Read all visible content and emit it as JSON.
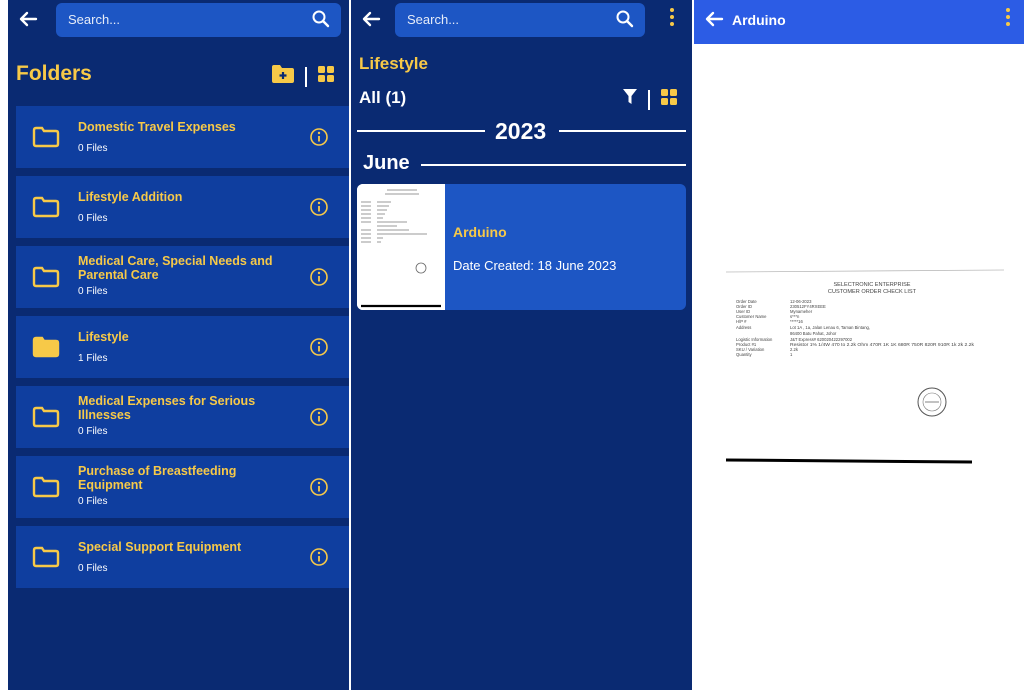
{
  "screen1": {
    "search_placeholder": "Search...",
    "title": "Folders",
    "folders": [
      {
        "name": "Domestic Travel Expenses",
        "count": "0 Files",
        "filled": false
      },
      {
        "name": "Lifestyle Addition",
        "count": "0 Files",
        "filled": false
      },
      {
        "name": "Medical Care, Special Needs and Parental Care",
        "count": "0 Files",
        "filled": false
      },
      {
        "name": "Lifestyle",
        "count": "1 Files",
        "filled": true
      },
      {
        "name": "Medical Expenses for Serious Illnesses",
        "count": "0 Files",
        "filled": false
      },
      {
        "name": "Purchase of Breastfeeding Equipment",
        "count": "0 Files",
        "filled": false
      },
      {
        "name": "Special Support Equipment",
        "count": "0 Files",
        "filled": false
      }
    ]
  },
  "screen2": {
    "search_placeholder": "Search...",
    "title": "Lifestyle",
    "filter_label": "All (1)",
    "year": "2023",
    "month": "June",
    "document": {
      "title": "Arduino",
      "date": "Date Created: 18 June 2023"
    }
  },
  "screen3": {
    "title": "Arduino",
    "receipt": {
      "company": "SELECTRONIC ENTERPRISE",
      "heading": "CUSTOMER ORDER CHECK LIST",
      "fields": [
        {
          "label": "Order Date",
          "value": "12-06-2023"
        },
        {
          "label": "Order ID",
          "value": "230512FY4RXEEE"
        },
        {
          "label": "User ID",
          "value": "Mynameher"
        },
        {
          "label": "Customer Name",
          "value": "s***n"
        },
        {
          "label": "H/P #",
          "value": "*****16"
        },
        {
          "label": "Address",
          "value": "Lot 1A , 1a, Jalan Lenau 6, Taman Bintang,"
        },
        {
          "label": "",
          "value": "86400 Batu Pahat, Johor"
        },
        {
          "label": "Logistic Information",
          "value": "J&T Express# 620020422297002"
        },
        {
          "label": "Product #1",
          "value": "Resistor 1% 1/4W 470 to 2.2k Ohm 470R 1K 1K 680R 750R 820R 910R 1k 2k 2.2k"
        },
        {
          "label": "SKU / Variation",
          "value": "2.2k"
        },
        {
          "label": "Quantity",
          "value": "1"
        }
      ]
    }
  },
  "colors": {
    "background": "#0a2a72",
    "card": "#0f3e9f",
    "accent": "#f7c948",
    "search": "#1d56c4",
    "appbar3": "#2c5ce5"
  }
}
